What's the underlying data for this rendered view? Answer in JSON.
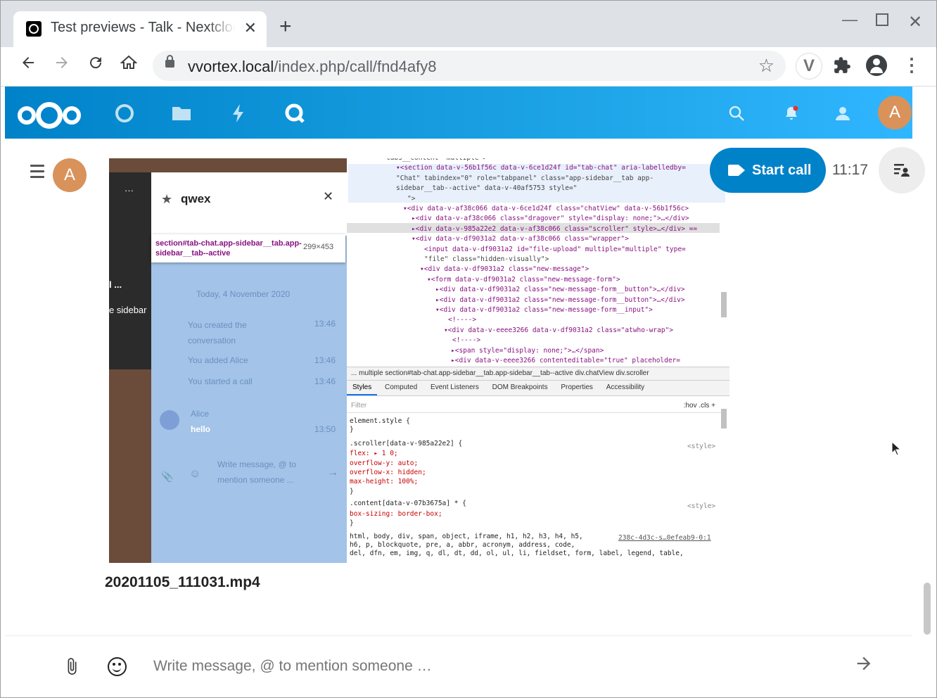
{
  "browser": {
    "tab_title": "Test previews - Talk - Nextcloud",
    "tab_close": "✕",
    "new_tab": "+",
    "url_host": "vvortex.local",
    "url_path": "/index.php/call/fnd4afy8",
    "extension_label": "V"
  },
  "header": {
    "user_initial": "A"
  },
  "conversation": {
    "user_initial": "A",
    "start_call_label": "Start call",
    "message_time": "11:17",
    "file_name": "20201105_111031.mp4",
    "composer_placeholder": "Write message, @ to mention someone …"
  },
  "preview": {
    "left_label_1": "l ...",
    "left_label_2": "e sidebar",
    "left_dots": "···",
    "panel_title": "qwex",
    "tooltip_selector": "section#tab-chat.app-sidebar__tab.app-sidebar__tab--active",
    "tooltip_size": "299×453",
    "date_separator": "Today, 4 November 2020",
    "messages": [
      {
        "text": "You created the conversation",
        "time": "13:46"
      },
      {
        "text": "You added  Alice",
        "time": "13:46"
      },
      {
        "text": "You started a call",
        "time": "13:46"
      }
    ],
    "alice_name": "Alice",
    "alice_message": "hello",
    "alice_time": "13:50",
    "inner_placeholder": "Write message, @ to mention someone ...",
    "dom_lines": [
      "tabs__content--multiple >",
      "▾<section data-v-56b1f56c data-v-6ce1d24f id=\"tab-chat\" aria-labelledby=",
      "\"Chat\" tabindex=\"0\" role=\"tabpanel\" class=\"app-sidebar__tab app-",
      "sidebar__tab--active\" data-v-40af5753 style=\"",
      "\">",
      "▾<div data-v-af38c066 data-v-6ce1d24f class=\"chatView\" data-v-56b1f56c>",
      "▸<div data-v-af38c066 class=\"dragover\" style=\"display: none;\">…</div>",
      "▸<div data-v-985a22e2 data-v-af38c066 class=\"scroller\" style>…</div> ==",
      "▾<div data-v-df9031a2 data-v-af38c066 class=\"wrapper\">",
      "<input data-v-df9031a2 id=\"file-upload\" multiple=\"multiple\" type=",
      "\"file\" class=\"hidden-visually\">",
      "▾<div data-v-df9031a2 class=\"new-message\">",
      "▾<form data-v-df9031a2 class=\"new-message-form\">",
      "▸<div data-v-df9031a2 class=\"new-message-form__button\">…</div>",
      "▸<div data-v-df9031a2 class=\"new-message-form__button\">…</div>",
      "▾<div data-v-df9031a2 class=\"new-message-form__input\">",
      "<!---->",
      "▾<div data-v-eeee3266 data-v-df9031a2 class=\"atwho-wrap\">",
      "<!---->",
      "▸<span style=\"display: none;\">…</span>",
      "▸<div data-v-eeee3266 contenteditable=\"true\" placeholder="
    ],
    "breadcrumbs": "...  multiple   section#tab-chat.app-sidebar__tab.app-sidebar__tab--active   div.chatView   div.scroller",
    "devtools_tabs": [
      "Styles",
      "Computed",
      "Event Listeners",
      "DOM Breakpoints",
      "Properties",
      "Accessibility"
    ],
    "filter_placeholder": "Filter",
    "filter_tools": ":hov  .cls  +",
    "css_lines": [
      "element.style {",
      "}",
      ".scroller[data-v-985a22e2] {",
      "  flex: ▸ 1 0;",
      "  overflow-y: auto;",
      "  overflow-x: hidden;",
      "  max-height: 100%;",
      "}",
      ".content[data-v-07b3675a] * {",
      "  box-sizing: border-box;",
      "}",
      "html, body, div, span, object, iframe, h1, h2, h3, h4, h5,",
      "h6, p, blockquote, pre, a, abbr, acronym, address, code,",
      "del, dfn, em, img, q, dl, dt, dd, ol, ul, li, fieldset, form, label, legend, table,"
    ],
    "style_src_1": "<style>",
    "style_src_2": "<style>",
    "style_src_3": "238c-4d3c-s…0efeab9-0:1"
  },
  "colors": {
    "brand": "#0082c9",
    "avatar": "#d8925a"
  },
  "icons": {
    "back": "arrow-left-icon",
    "forward": "arrow-right-icon",
    "reload": "reload-icon",
    "home": "home-icon",
    "bookmark": "star-icon",
    "extensions": "puzzle-icon",
    "profile": "account-icon",
    "menu": "kebab-icon",
    "search": "search-icon",
    "notifications": "bell-icon",
    "contacts": "contacts-icon",
    "attach": "paperclip-icon",
    "emoji": "emoji-icon",
    "send": "send-arrow-icon"
  }
}
